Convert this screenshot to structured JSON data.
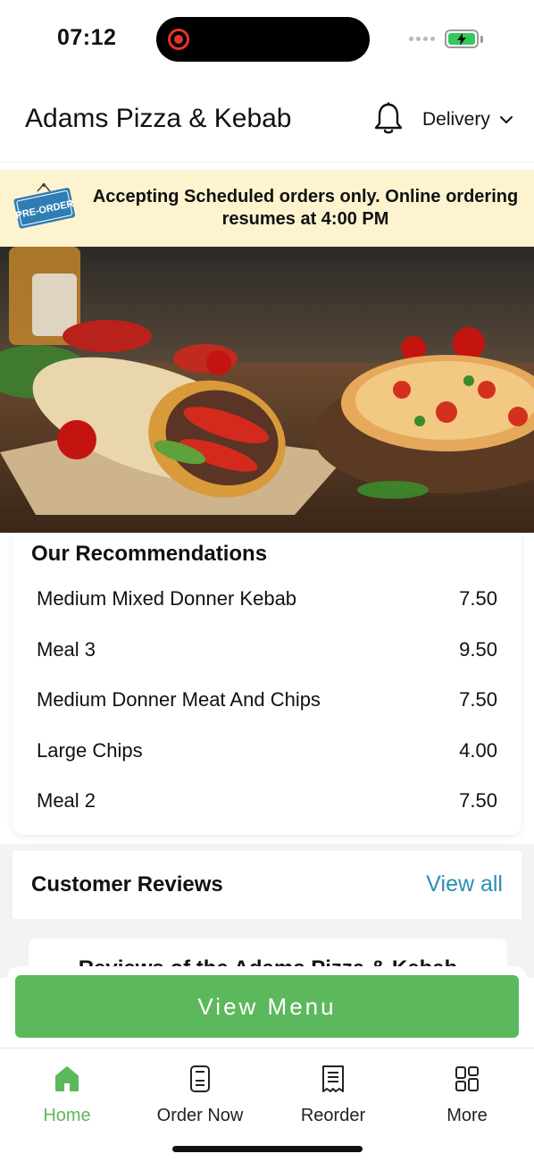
{
  "status_bar": {
    "time": "07:12",
    "battery_level": 1.0,
    "battery_icon": "battery-charging-icon",
    "recording_indicator_icon": "screen-recording-icon"
  },
  "header": {
    "store_name": "Adams Pizza & Kebab",
    "notification_icon": "bell-icon",
    "fulfilment_mode": "Delivery",
    "dropdown_icon": "chevron-down-icon"
  },
  "banner": {
    "tag_label": "PRE-ORDER",
    "message": "Accepting Scheduled orders only. Online ordering resumes at 4:00 PM",
    "background_color": "#fdf3cf"
  },
  "recommendations": {
    "title": "Our Recommendations",
    "items": [
      {
        "name": "Medium Mixed Donner Kebab",
        "price": "7.50"
      },
      {
        "name": "Meal 3",
        "price": "9.50"
      },
      {
        "name": "Medium Donner Meat And Chips",
        "price": "7.50"
      },
      {
        "name": "Large Chips",
        "price": "4.00"
      },
      {
        "name": "Meal 2",
        "price": "7.50"
      }
    ]
  },
  "reviews": {
    "title": "Customer Reviews",
    "view_all_label": "View all",
    "view_all_color": "#2a8fb4",
    "card_title": "Reviews of the Adams Pizza & Kebab"
  },
  "cta": {
    "view_menu_label": "View Menu",
    "color": "#5cb85c"
  },
  "bottom_nav": {
    "active_color": "#5cb85c",
    "items": [
      {
        "label": "Home",
        "icon": "home-icon",
        "active": true
      },
      {
        "label": "Order Now",
        "icon": "order-icon",
        "active": false
      },
      {
        "label": "Reorder",
        "icon": "receipt-icon",
        "active": false
      },
      {
        "label": "More",
        "icon": "grid-icon",
        "active": false
      }
    ]
  }
}
